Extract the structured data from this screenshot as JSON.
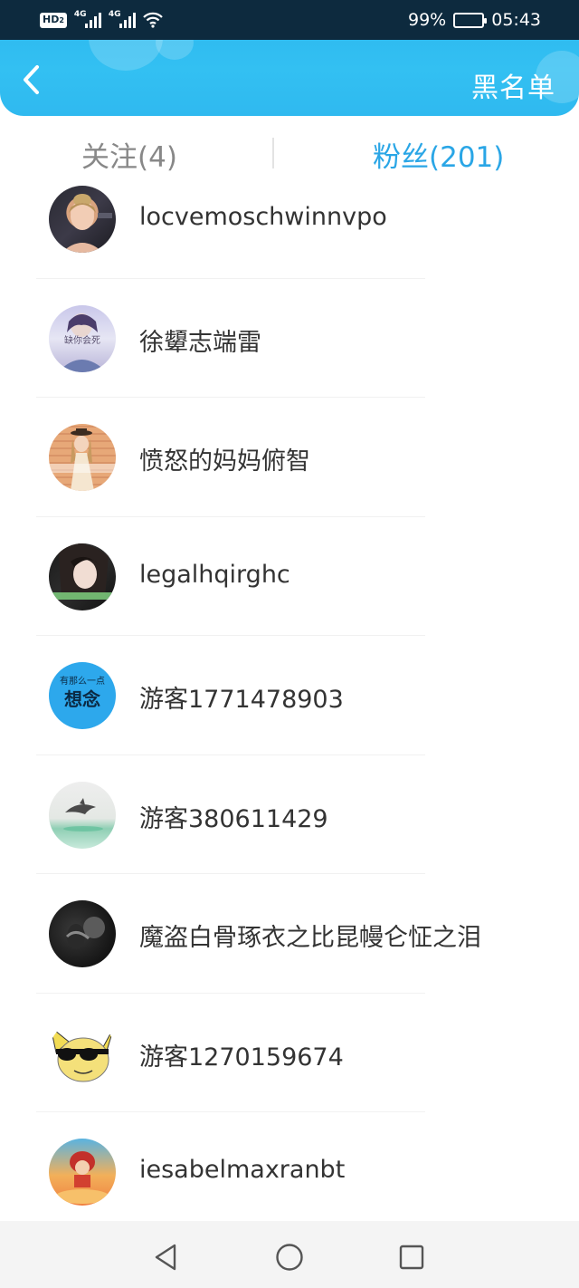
{
  "status_bar": {
    "hd_label": "HD",
    "hd_sub": "2",
    "signal_1_label": "4G",
    "signal_2_label": "4G",
    "battery_percent": "99%",
    "battery_level": 0.99,
    "time": "05:43"
  },
  "header": {
    "back_icon": "chevron-left-icon",
    "blacklist_label": "黑名单"
  },
  "tabs": [
    {
      "label": "关注(4)",
      "active": false
    },
    {
      "label": "粉丝(201)",
      "active": true
    }
  ],
  "fans": [
    {
      "name": "locvemoschwinnvpo"
    },
    {
      "name": "徐顰志端雷"
    },
    {
      "name": "愤怒的妈妈俯智"
    },
    {
      "name": "legalhqirghc"
    },
    {
      "name": "游客1771478903"
    },
    {
      "name": "游客380611429"
    },
    {
      "name": "魔盗白骨琢衣之比昆幔仑怔之泪"
    },
    {
      "name": "游客1270159674"
    },
    {
      "name": "iesabelmaxranbt"
    }
  ],
  "avatar_texts": {
    "a2": "缺你会死",
    "a5_top": "有那么一点",
    "a5_main": "想念"
  },
  "system_nav": {
    "back_icon": "triangle-back-icon",
    "home_icon": "circle-home-icon",
    "recent_icon": "square-recents-icon"
  },
  "colors": {
    "header_blue": "#2bb6ee",
    "status_bar": "#0d2a3e",
    "active_tab": "#2aa6e6",
    "inactive_tab": "#888888"
  }
}
